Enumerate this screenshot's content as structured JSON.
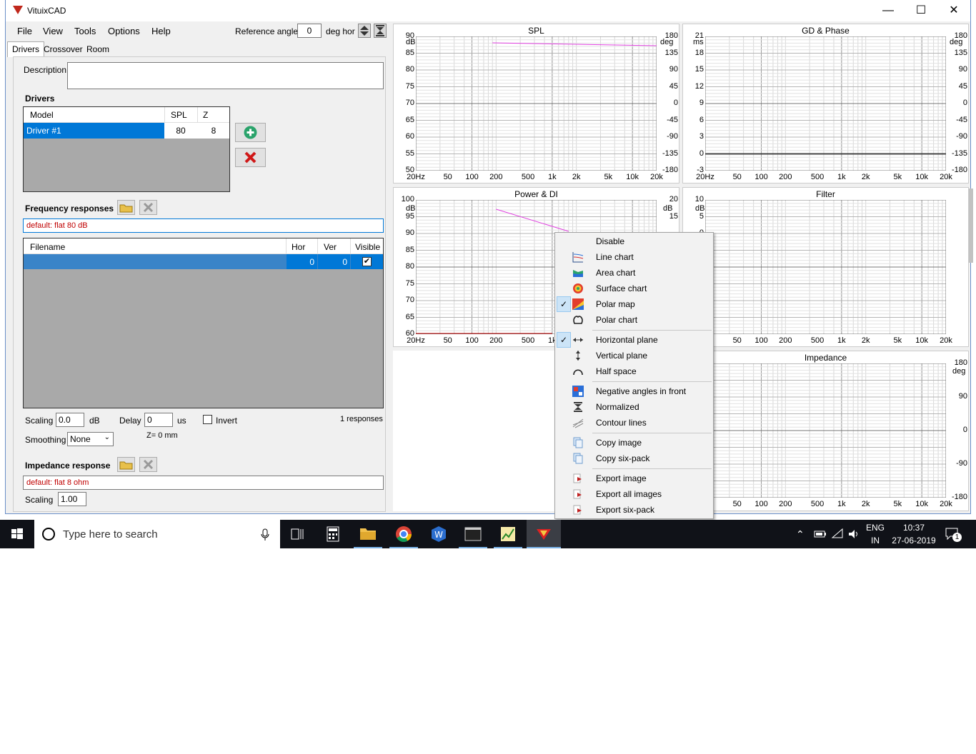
{
  "window": {
    "title": "VituixCAD",
    "minimize": "—",
    "maximize": "☐",
    "close": "✕"
  },
  "menu": [
    "File",
    "View",
    "Tools",
    "Options",
    "Help"
  ],
  "reference": {
    "label": "Reference angle",
    "value": "0",
    "unit": "deg hor"
  },
  "tabs": [
    "Drivers",
    "Crossover",
    "Room"
  ],
  "drivers_tab": {
    "description_label": "Description",
    "description_value": "",
    "drivers_heading": "Drivers",
    "driver_columns": [
      "Model",
      "SPL",
      "Z"
    ],
    "drivers": [
      {
        "model": "Driver #1",
        "spl": "80",
        "z": "8"
      }
    ],
    "freq_heading": "Frequency responses",
    "freq_default": "default: flat 80 dB",
    "freq_columns": [
      "Filename",
      "Hor",
      "Ver",
      "Visible"
    ],
    "freq_rows": [
      {
        "filename": "",
        "hor": "0",
        "ver": "0",
        "visible": true
      }
    ],
    "scaling_label": "Scaling",
    "scaling_value": "0.0",
    "scaling_unit": "dB",
    "delay_label": "Delay",
    "delay_value": "0",
    "delay_unit": "us",
    "invert_label": "Invert",
    "responses_count": "1 responses",
    "smoothing_label": "Smoothing",
    "smoothing_value": "None",
    "z_label": "Z= 0 mm",
    "imp_heading": "Impedance response",
    "imp_default": "default: flat 8 ohm",
    "imp_scaling_label": "Scaling",
    "imp_scaling_value": "1.00"
  },
  "charts": {
    "spl": {
      "title": "SPL",
      "yleft_unit": "dB",
      "yright_unit": "deg",
      "yleft": [
        "90",
        "85",
        "80",
        "75",
        "70",
        "65",
        "60",
        "55",
        "50"
      ],
      "yright": [
        "180",
        "135",
        "90",
        "45",
        "0",
        "-45",
        "-90",
        "-135",
        "-180"
      ]
    },
    "gd": {
      "title": "GD & Phase",
      "yleft_unit": "ms",
      "yright_unit": "deg",
      "yleft": [
        "21",
        "18",
        "15",
        "12",
        "9",
        "6",
        "3",
        "0",
        "-3"
      ],
      "yright": [
        "180",
        "135",
        "90",
        "45",
        "0",
        "-45",
        "-90",
        "-135",
        "-180"
      ]
    },
    "power": {
      "title": "Power & DI",
      "yleft_unit": "dB",
      "yright_unit": "dB",
      "yleft": [
        "100",
        "95",
        "90",
        "85",
        "80",
        "75",
        "70",
        "65",
        "60"
      ],
      "yright": [
        "20",
        "15"
      ]
    },
    "filter": {
      "title": "Filter",
      "yleft_unit": "dB",
      "yleft": [
        "10",
        "5",
        "0"
      ]
    },
    "impedance": {
      "title": "Impedance",
      "yright_unit": "deg",
      "yright": [
        "180",
        "90",
        "0",
        "-90",
        "-180"
      ]
    },
    "xticks": [
      "20Hz",
      "50",
      "100",
      "200",
      "500",
      "1k",
      "2k",
      "5k",
      "10k",
      "20k"
    ],
    "xticks_short": [
      "50",
      "100",
      "200",
      "500",
      "1k",
      "2k",
      "5k",
      "10k",
      "20k"
    ]
  },
  "context_menu": {
    "items": [
      {
        "label": "Disable",
        "icon": "blank-icon",
        "checked": false
      },
      {
        "label": "Line chart",
        "icon": "line-chart-icon",
        "checked": false
      },
      {
        "label": "Area chart",
        "icon": "area-chart-icon",
        "checked": false
      },
      {
        "label": "Surface chart",
        "icon": "surface-chart-icon",
        "checked": false
      },
      {
        "label": "Polar map",
        "icon": "polar-map-icon",
        "checked": true
      },
      {
        "label": "Polar chart",
        "icon": "polar-chart-icon",
        "checked": false
      },
      {
        "label": "Horizontal plane",
        "icon": "horizontal-arrows-icon",
        "checked": true
      },
      {
        "label": "Vertical plane",
        "icon": "vertical-arrows-icon",
        "checked": false
      },
      {
        "label": "Half space",
        "icon": "half-space-icon",
        "checked": false
      },
      {
        "label": "Negative angles in front",
        "icon": "negative-angles-icon",
        "checked": false
      },
      {
        "label": "Normalized",
        "icon": "normalized-icon",
        "checked": false
      },
      {
        "label": "Contour lines",
        "icon": "contour-icon",
        "checked": false
      },
      {
        "label": "Copy image",
        "icon": "copy-icon",
        "checked": false
      },
      {
        "label": "Copy six-pack",
        "icon": "copy-icon",
        "checked": false
      },
      {
        "label": "Export image",
        "icon": "export-icon",
        "checked": false
      },
      {
        "label": "Export all images",
        "icon": "export-icon",
        "checked": false
      },
      {
        "label": "Export six-pack",
        "icon": "export-icon",
        "checked": false
      }
    ]
  },
  "taskbar": {
    "search_placeholder": "Type here to search",
    "lang": "ENG",
    "region": "IN",
    "time": "10:37",
    "date": "27-06-2019",
    "notifications": "1"
  },
  "colors": {
    "accent": "#0078d7",
    "curve": "#e040e0",
    "default_text": "#c00000"
  }
}
